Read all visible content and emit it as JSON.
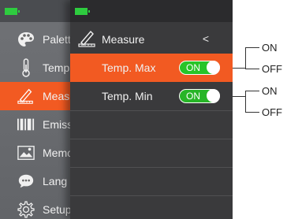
{
  "menu": {
    "items": [
      {
        "label": "Palette",
        "icon": "palette-icon"
      },
      {
        "label": "Temp",
        "icon": "thermometer-icon"
      },
      {
        "label": "Measure",
        "icon": "ruler-pen-icon",
        "active": true
      },
      {
        "label": "Emiss",
        "icon": "barcode-icon"
      },
      {
        "label": "Memo",
        "icon": "image-icon"
      },
      {
        "label": "Lang",
        "icon": "chat-bubble-icon"
      },
      {
        "label": "Setup",
        "icon": "gear-icon"
      }
    ]
  },
  "submenu": {
    "title": "Measure",
    "back": "<",
    "rows": [
      {
        "label": "Temp. Max",
        "toggle": "ON",
        "highlighted": true
      },
      {
        "label": "Temp. Min",
        "toggle": "ON",
        "highlighted": false
      }
    ]
  },
  "callouts": {
    "max_on": "ON",
    "max_off": "OFF",
    "min_on": "ON",
    "min_off": "OFF"
  },
  "colors": {
    "accent": "#f25a22",
    "toggle_on": "#28c428",
    "battery": "#2ecc3f"
  }
}
